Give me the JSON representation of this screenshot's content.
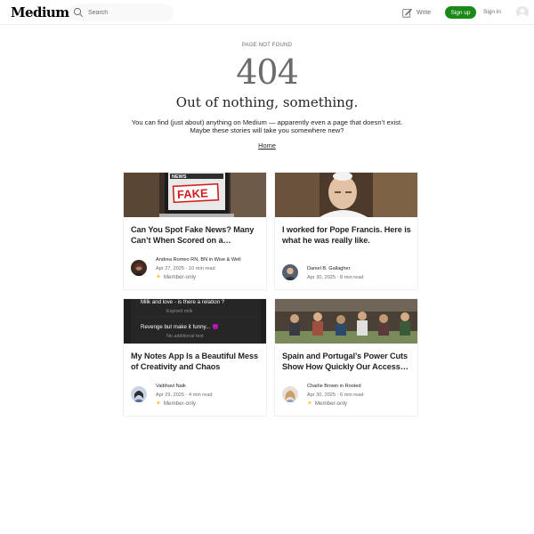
{
  "header": {
    "logo": "Medium",
    "search_placeholder": "Search",
    "write_label": "Write",
    "signup_label": "Sign up",
    "signin_label": "Sign in"
  },
  "error": {
    "kicker": "PAGE NOT FOUND",
    "code": "404",
    "headline": "Out of nothing, something.",
    "blurb_line1": "You can find (just about) anything on Medium — apparently even a page that doesn’t exist.",
    "blurb_line2": "Maybe these stories will take you somewhere new?",
    "home_link": "Home"
  },
  "colors": {
    "brand_green": "#1a8917",
    "member_star": "#ffc017",
    "muted_text": "#6b6b6b"
  },
  "stories": [
    {
      "title": "Can You Spot Fake News? Many Can’t When Scored on a…",
      "author": "Andrea Romeo RN, BN in Wise & Well",
      "date": "Apr 27, 2025",
      "read_time": "10 min read",
      "member_label": "Member-only",
      "thumb_text_top": "NEWS",
      "thumb_text_main": "FAKE"
    },
    {
      "title": "I worked for Pope Francis. Here is what he was really like.",
      "author": "Daniel B. Gallagher",
      "date": "Apr 30, 2025",
      "read_time": "8 min read"
    },
    {
      "title": "My Notes App Is a Beautiful Mess of Creativity and Chaos",
      "author": "Vaibhavi Naik",
      "date": "Apr 29, 2025",
      "read_time": "4 min read",
      "member_label": "Member-only",
      "thumb_line1": "Milk and love - is there a relation ?",
      "thumb_line2": "Expired milk",
      "thumb_line3": "Revenge but make it funny... 😈",
      "thumb_line4": "No additional text"
    },
    {
      "title": "Spain and Portugal’s Power Cuts Show How Quickly Our Access…",
      "author": "Charlie Brown in Rooted",
      "date": "Apr 30, 2025",
      "read_time": "6 min read",
      "member_label": "Member-only"
    }
  ]
}
